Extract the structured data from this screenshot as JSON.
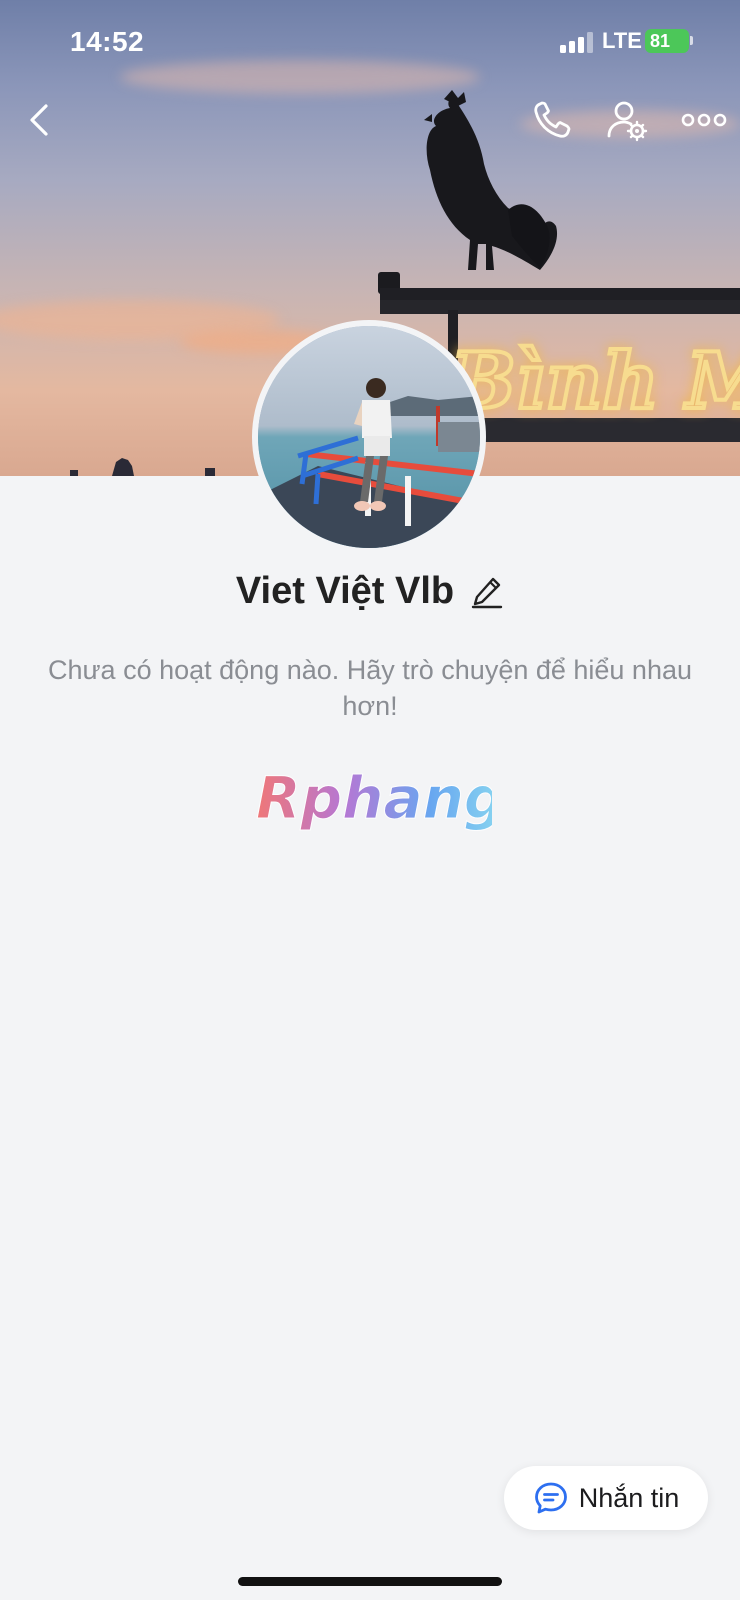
{
  "status_bar": {
    "time": "14:52",
    "network": "LTE",
    "battery": "81"
  },
  "nav": {
    "back_icon": "chevron-left-icon",
    "call_icon": "phone-icon",
    "settings_icon": "user-settings-icon",
    "more_icon": "more-dots-icon"
  },
  "cover": {
    "sign_text": "Bình Minh"
  },
  "profile": {
    "name": "Viet Việt Vlb",
    "activity_text": "Chưa có hoạt động nào. Hãy trò chuyện để hiểu nhau hơn!"
  },
  "watermark": {
    "text": "Rphang"
  },
  "actions": {
    "message_label": "Nhắn tin"
  },
  "colors": {
    "accent": "#2d6ff0",
    "background": "#f3f4f6",
    "battery": "#4cc759",
    "neon": "#f6d27a"
  }
}
